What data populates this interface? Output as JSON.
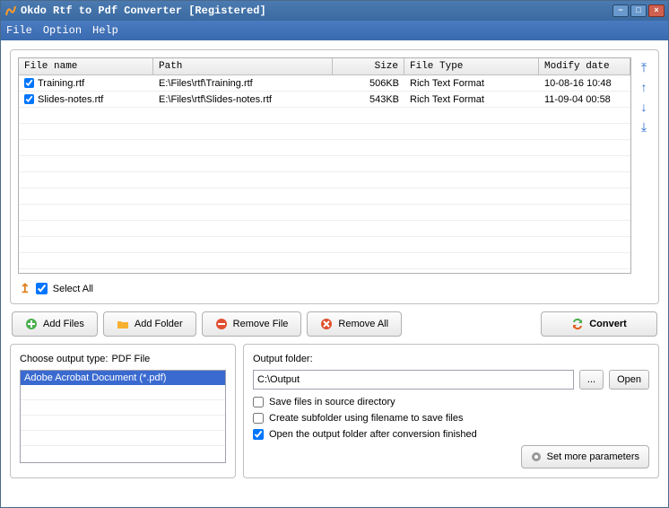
{
  "title": "Okdo Rtf to Pdf Converter [Registered]",
  "menu": {
    "file": "File",
    "option": "Option",
    "help": "Help"
  },
  "columns": {
    "filename": "File name",
    "path": "Path",
    "size": "Size",
    "filetype": "File Type",
    "modify": "Modify date"
  },
  "rows": [
    {
      "checked": true,
      "name": "Training.rtf",
      "path": "E:\\Files\\rtf\\Training.rtf",
      "size": "506KB",
      "type": "Rich Text Format",
      "modify": "10-08-16 10:48"
    },
    {
      "checked": true,
      "name": "Slides-notes.rtf",
      "path": "E:\\Files\\rtf\\Slides-notes.rtf",
      "size": "543KB",
      "type": "Rich Text Format",
      "modify": "11-09-04 00:58"
    }
  ],
  "selectAll": "Select All",
  "buttons": {
    "addFiles": "Add Files",
    "addFolder": "Add Folder",
    "removeFile": "Remove File",
    "removeAll": "Remove All",
    "convert": "Convert"
  },
  "outputType": {
    "label": "Choose output type:",
    "value": "PDF File",
    "option": "Adobe Acrobat Document (*.pdf)"
  },
  "outputFolder": {
    "label": "Output folder:",
    "value": "C:\\Output",
    "browse": "...",
    "open": "Open"
  },
  "checks": {
    "saveSource": {
      "label": "Save files in source directory",
      "checked": false
    },
    "subfolder": {
      "label": "Create subfolder using filename to save files",
      "checked": false
    },
    "openAfter": {
      "label": "Open the output folder after conversion finished",
      "checked": true
    }
  },
  "moreParams": "Set more parameters"
}
